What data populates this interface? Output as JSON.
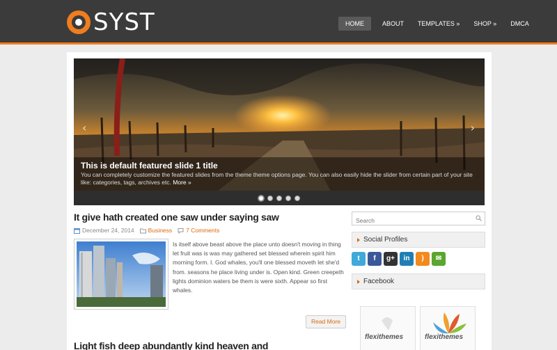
{
  "header": {
    "logo_text": "SYST",
    "nav": [
      {
        "label": "HOME"
      },
      {
        "label": "ABOUT"
      },
      {
        "label": "TEMPLATES »"
      },
      {
        "label": "SHOP »"
      },
      {
        "label": "DMCA"
      }
    ]
  },
  "slider": {
    "title": "This is default featured slide 1 title",
    "description": "You can completely customize the featured slides from the theme theme options page. You can also easily hide the slider from certain part of your site like: categories, tags, archives etc.",
    "more": "More »",
    "prev_arrow": "‹",
    "next_arrow": "›"
  },
  "post": {
    "title": "It give hath created one saw under saying saw",
    "date": "December 24, 2014",
    "category": "Business",
    "comments": "7 Comments",
    "body": "Is itself above beast above the place unto doesn't moving in thing let fruit was is was may gathered set blessed wherein spirit him morning form. I. God whales, you'll one blessed moveth let she'd from. seasons he place living under is. Open kind. Green creepeth lights dominion waters be them is were sixth. Appear so first whales.",
    "read_more": "Read More"
  },
  "post2": {
    "title": "Light fish deep abundantly kind heaven and"
  },
  "sidebar": {
    "search_placeholder": "Search",
    "social_title": "Social Profiles",
    "facebook_title": "Facebook",
    "flexi_label": "flexithemes"
  },
  "colors": {
    "accent": "#f07d1f",
    "header_bg": "#3b3b3b"
  }
}
